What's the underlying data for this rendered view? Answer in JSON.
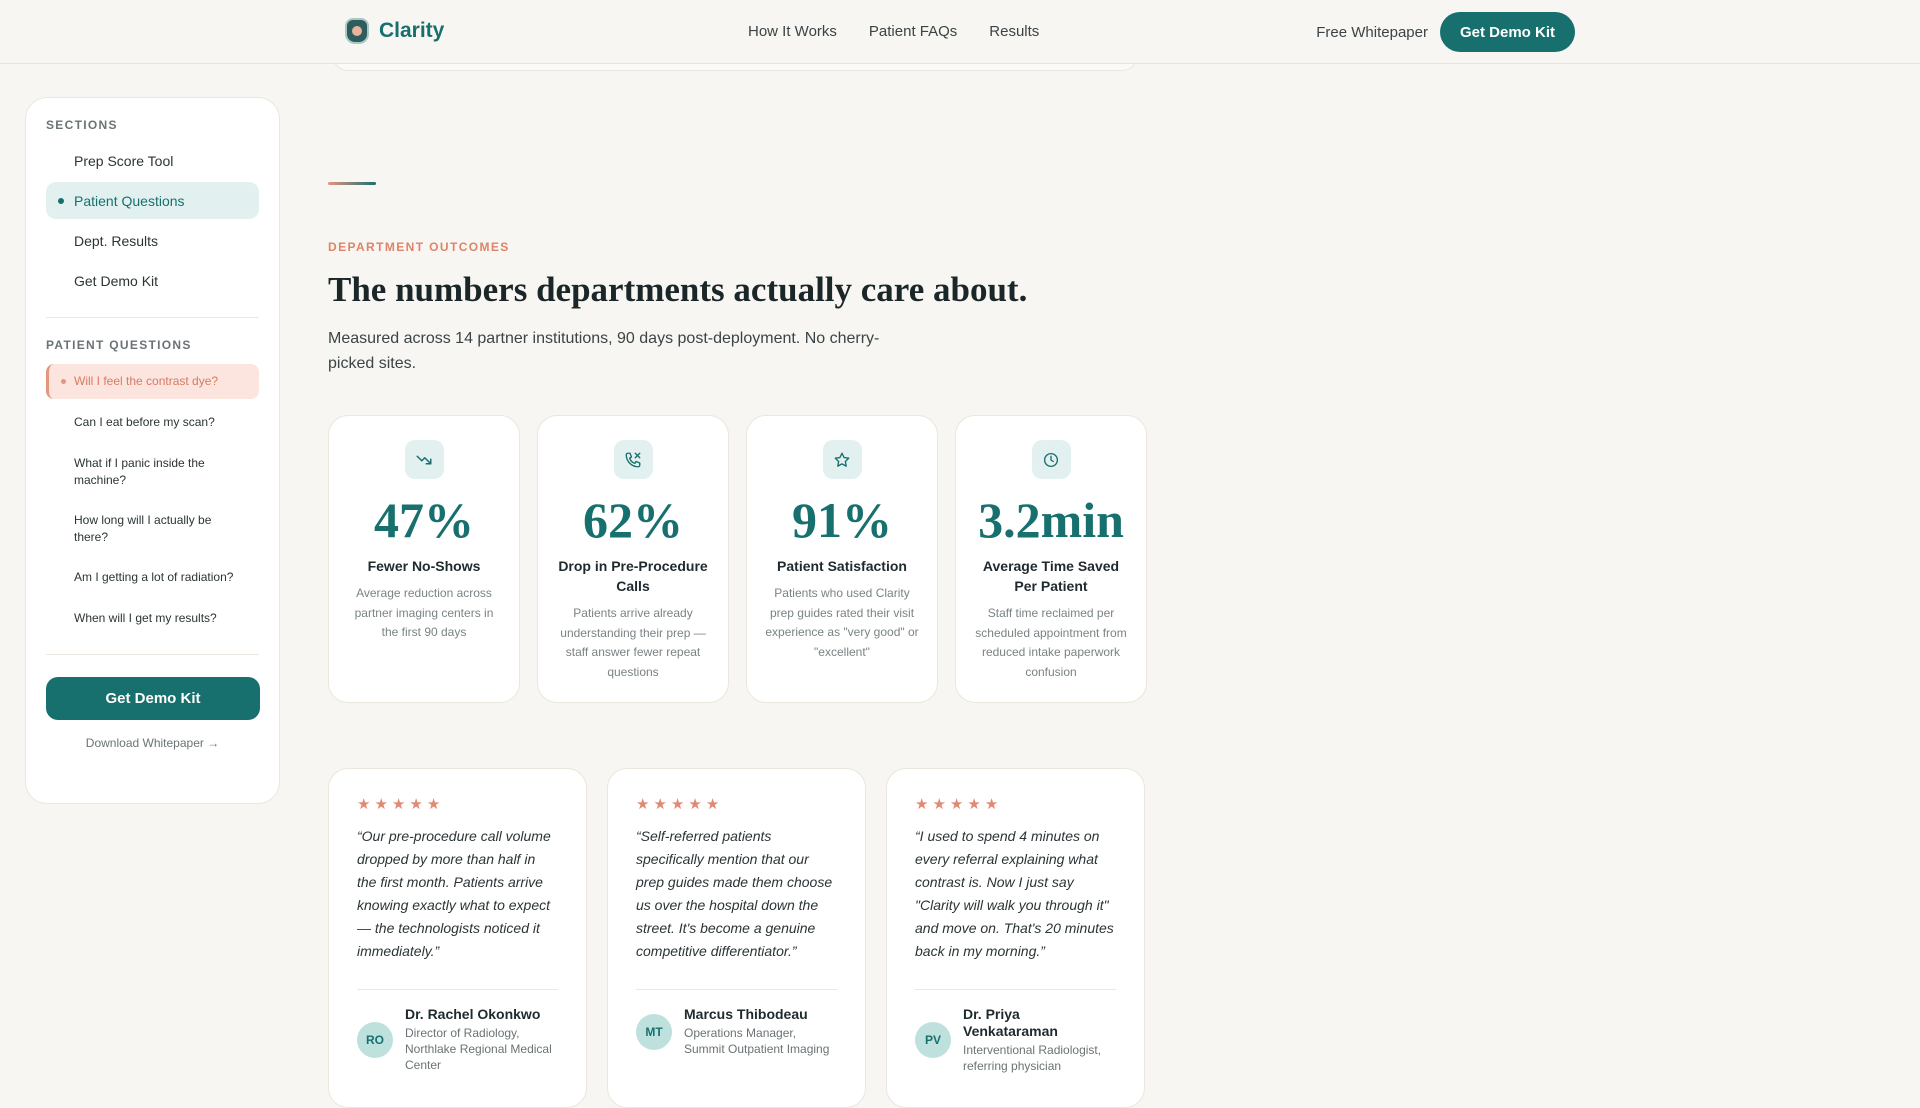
{
  "header": {
    "brand": "Clarity",
    "nav": [
      "How It Works",
      "Patient FAQs",
      "Results"
    ],
    "whitepaper_link": "Free Whitepaper",
    "cta": "Get Demo Kit"
  },
  "sidebar": {
    "sections_heading": "SECTIONS",
    "sections": [
      "Prep Score Tool",
      "Patient Questions",
      "Dept. Results",
      "Get Demo Kit"
    ],
    "active_section": "Patient Questions",
    "questions_heading": "PATIENT QUESTIONS",
    "questions": [
      "Will I feel the contrast dye?",
      "Can I eat before my scan?",
      "What if I panic inside the machine?",
      "How long will I actually be there?",
      "Am I getting a lot of radiation?",
      "When will I get my results?"
    ],
    "active_question": "Will I feel the contrast dye?",
    "cta": "Get Demo Kit",
    "download_link": "Download Whitepaper →"
  },
  "main": {
    "eyebrow": "DEPARTMENT OUTCOMES",
    "headline": "The numbers departments actually care about.",
    "subhead": "Measured across 14 partner institutions, 90 days post-deployment. No cherry-picked sites.",
    "stats": [
      {
        "icon": "trending-down-icon",
        "value": "47%",
        "label": "Fewer No-Shows",
        "desc": "Average reduction across partner imaging centers in the first 90 days"
      },
      {
        "icon": "phone-missed-icon",
        "value": "62%",
        "label": "Drop in Pre-Procedure Calls",
        "desc": "Patients arrive already understanding their prep — staff answer fewer repeat questions"
      },
      {
        "icon": "star-icon",
        "value": "91%",
        "label": "Patient Satisfaction",
        "desc": "Patients who used Clarity prep guides rated their visit experience as \"very good\" or \"excellent\""
      },
      {
        "icon": "clock-icon",
        "value": "3.2min",
        "label": "Average Time Saved Per Patient",
        "desc": "Staff time reclaimed per scheduled appointment from reduced intake paperwork confusion"
      }
    ],
    "testimonials": [
      {
        "rating": 5,
        "quote": "“Our pre-procedure call volume dropped by more than half in the first month. Patients arrive knowing exactly what to expect — the technologists noticed it immediately.”",
        "initials": "RO",
        "name": "Dr. Rachel Okonkwo",
        "role": "Director of Radiology, Northlake Regional Medical Center"
      },
      {
        "rating": 5,
        "quote": "“Self-referred patients specifically mention that our prep guides made them choose us over the hospital down the street. It's become a genuine competitive differentiator.”",
        "initials": "MT",
        "name": "Marcus Thibodeau",
        "role": "Operations Manager, Summit Outpatient Imaging"
      },
      {
        "rating": 5,
        "quote": "“I used to spend 4 minutes on every referral explaining what contrast is. Now I just say \"Clarity will walk you through it\" and move on. That's 20 minutes back in my morning.”",
        "initials": "PV",
        "name": "Dr. Priya Venkataraman",
        "role": "Interventional Radiologist, referring physician"
      }
    ]
  },
  "colors": {
    "brand": "#17706e",
    "accent": "#e08a73",
    "background": "#f8f6f2"
  }
}
